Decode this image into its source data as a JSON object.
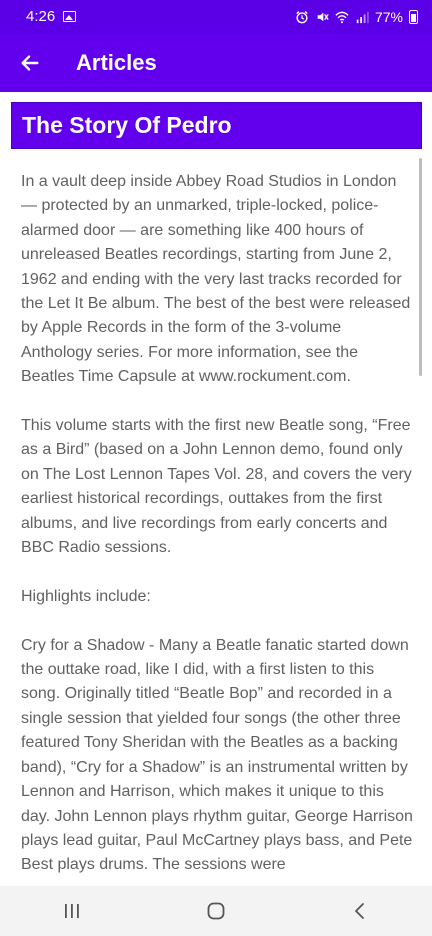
{
  "status_bar": {
    "time": "4:26",
    "battery": "77%",
    "icons": [
      "gallery-icon",
      "alarm-icon",
      "mute-icon",
      "wifi-icon",
      "signal-icon",
      "battery-icon"
    ]
  },
  "app_bar": {
    "title": "Articles",
    "back_icon": "arrow-left-icon"
  },
  "article": {
    "title": "The Story Of Pedro",
    "paragraphs": [
      "In a vault deep inside Abbey Road Studios in London — protected by an unmarked, triple-locked, police-alarmed door — are something like 400 hours of unreleased Beatles recordings, starting from June 2, 1962 and ending with the very last tracks recorded for the Let It Be album. The best of the best were released by Apple Records in the form of the 3-volume Anthology series. For more information, see the Beatles Time Capsule at www.rockument.com.",
      " This volume starts with the first new Beatle song, “Free as a Bird” (based on a John Lennon demo, found only on The Lost Lennon Tapes Vol. 28, and covers the very earliest historical recordings, outtakes from the first albums, and live recordings from early concerts and BBC Radio sessions.",
      " Highlights include:",
      " Cry for a Shadow - Many a Beatle fanatic started down the outtake road, like I did, with a first listen to this song. Originally titled “Beatle Bop” and recorded in a single session that yielded four songs (the other three featured Tony Sheridan with the Beatles as a backing band), “Cry for a Shadow” is an instrumental written by Lennon and Harrison, which makes it unique to this day. John Lennon plays rhythm guitar, George Harrison plays lead guitar, Paul McCartney plays bass, and Pete Best plays drums. The sessions were"
    ]
  },
  "nav_bar": {
    "icons": [
      "recent-apps-icon",
      "home-icon",
      "back-icon"
    ]
  },
  "colors": {
    "status_bar": "#5b00e6",
    "app_bar": "#6200ee",
    "body_text": "#616161"
  }
}
